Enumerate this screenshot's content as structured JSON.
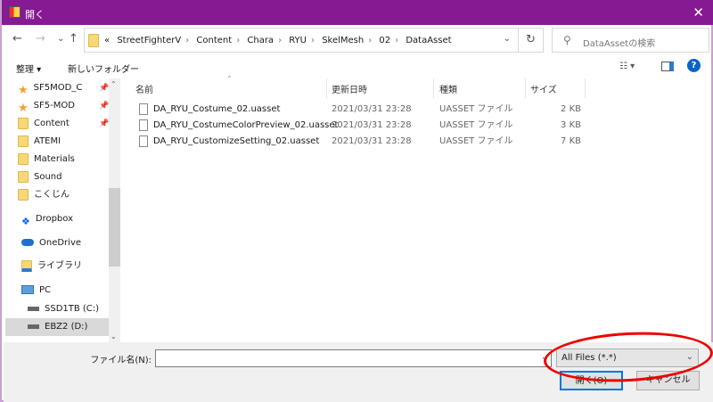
{
  "title": "開く",
  "nav": {
    "back": "←",
    "forward": "→",
    "recent": "⌄",
    "up": "↑"
  },
  "address": {
    "crumbs": [
      "«",
      "StreetFighterV",
      "Content",
      "Chara",
      "RYU",
      "SkelMesh",
      "02",
      "DataAsset"
    ]
  },
  "search": {
    "placeholder": "DataAssetの検索"
  },
  "toolbar": {
    "organize": "整理 ▾",
    "new_folder": "新しいフォルダー"
  },
  "sidebar": {
    "items": [
      {
        "label": "SF5MOD_C",
        "icon": "star-icon",
        "pinned": true
      },
      {
        "label": "SF5-MOD",
        "icon": "star-icon",
        "pinned": true
      },
      {
        "label": "Content",
        "icon": "folder-icon",
        "pinned": true
      },
      {
        "label": "ATEMI",
        "icon": "folder-icon"
      },
      {
        "label": "Materials",
        "icon": "folder-icon"
      },
      {
        "label": "Sound",
        "icon": "folder-icon"
      },
      {
        "label": "こくじん",
        "icon": "folder-icon"
      },
      {
        "label": "Dropbox",
        "icon": "dropbox-icon"
      },
      {
        "label": "OneDrive",
        "icon": "cloud-icon"
      },
      {
        "label": "ライブラリ",
        "icon": "library-icon"
      },
      {
        "label": "PC",
        "icon": "pc-icon"
      },
      {
        "label": "SSD1TB (C:)",
        "icon": "drive-icon"
      },
      {
        "label": "EBZ2 (D:)",
        "icon": "drive-icon",
        "selected": true
      }
    ]
  },
  "columns": [
    "名前",
    "更新日時",
    "種類",
    "サイズ"
  ],
  "files": [
    {
      "name": "DA_RYU_Costume_02.uasset",
      "date": "2021/03/31 23:28",
      "type": "UASSET ファイル",
      "size": "2 KB"
    },
    {
      "name": "DA_RYU_CostumeColorPreview_02.uasset",
      "date": "2021/03/31 23:28",
      "type": "UASSET ファイル",
      "size": "3 KB"
    },
    {
      "name": "DA_RYU_CustomizeSetting_02.uasset",
      "date": "2021/03/31 23:28",
      "type": "UASSET ファイル",
      "size": "7 KB"
    }
  ],
  "bottom": {
    "filename_label": "ファイル名(N):",
    "filename_value": "",
    "filter": "All Files (*.*)",
    "open": "開く(O)",
    "cancel": "キャンセル"
  },
  "colors": {
    "titlebar": "#861a93",
    "annotation": "#e00000"
  }
}
